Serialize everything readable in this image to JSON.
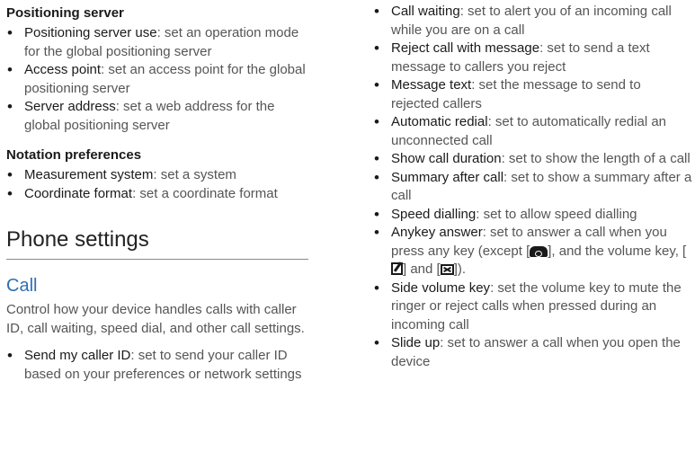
{
  "left": {
    "positioning_server": {
      "heading": "Positioning server",
      "items": [
        {
          "term": "Positioning server use",
          "desc": ": set an operation mode for the global positioning server"
        },
        {
          "term": "Access point",
          "desc": ": set an access point for the global positioning server"
        },
        {
          "term": "Server address",
          "desc": ": set a web address for the global positioning server"
        }
      ]
    },
    "notation": {
      "heading": "Notation preferences",
      "items": [
        {
          "term": "Measurement system",
          "desc": ": set a system"
        },
        {
          "term": "Coordinate format",
          "desc": ": set a coordinate format"
        }
      ]
    },
    "section_title": "Phone settings",
    "call": {
      "heading": "Call",
      "intro": "Control how your device handles calls with caller ID, call waiting, speed dial, and other call settings.",
      "items": [
        {
          "term": "Send my caller ID",
          "desc": ": set to send your caller ID based on your preferences or network settings"
        }
      ]
    }
  },
  "right": {
    "items": [
      {
        "term": "Call waiting",
        "desc": ": set to alert you of an incoming call while you are on a call"
      },
      {
        "term": "Reject call with message",
        "desc": ": set to send a text message to callers you reject"
      },
      {
        "term": "Message text",
        "desc": ": set the message to send to rejected callers"
      },
      {
        "term": "Automatic redial",
        "desc": ": set to automatically redial an unconnected call"
      },
      {
        "term": "Show call duration",
        "desc": ": set to show the length of a call"
      },
      {
        "term": "Summary after call",
        "desc": ": set to show a summary after a call"
      },
      {
        "term": "Speed dialling",
        "desc": ": set to allow speed dialling"
      }
    ],
    "anykey": {
      "term": "Anykey answer",
      "desc_a": ": set to answer a call when you press any key (except [",
      "desc_b": "], and the volume key, [",
      "desc_c": "] and [",
      "desc_d": "]).",
      "icon_end": "end-call-key-icon",
      "icon_memo": "memo-key-icon",
      "icon_msg": "message-key-icon"
    },
    "items2": [
      {
        "term": "Side volume key",
        "desc": ": set the volume key to mute the ringer or reject calls when pressed during an incoming call"
      },
      {
        "term": "Slide up",
        "desc": ": set to answer a call when you open the device"
      }
    ]
  }
}
